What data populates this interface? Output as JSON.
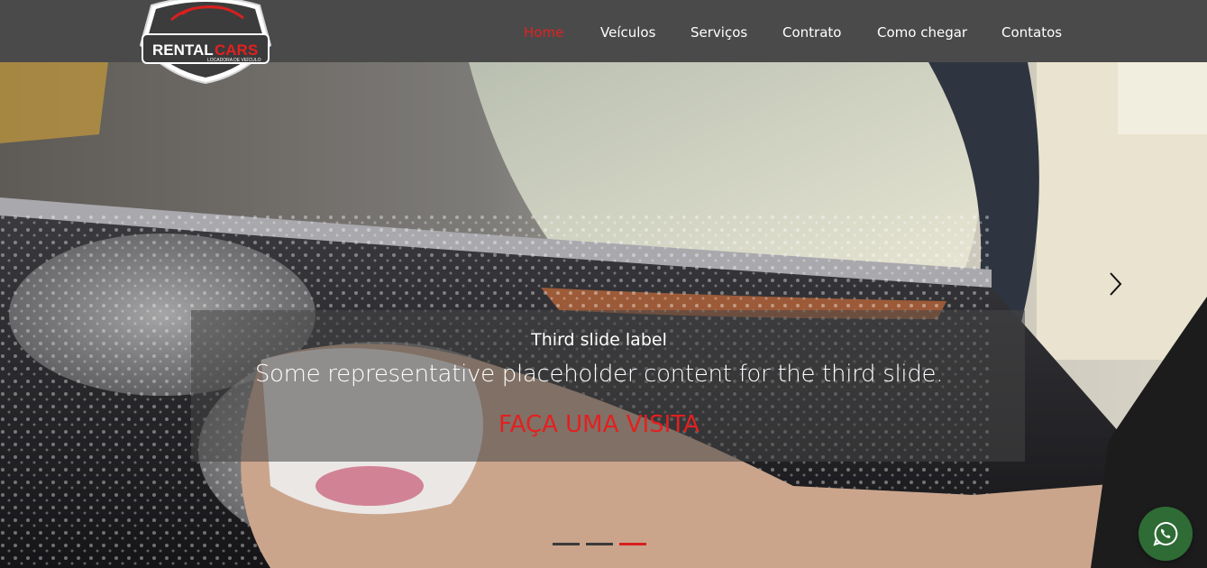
{
  "logo": {
    "brand_line1": "RENTAL",
    "brand_line2": "CARS",
    "tagline": "LOCADORA DE VEÍCULO"
  },
  "nav": {
    "items": [
      {
        "label": "Home",
        "active": true
      },
      {
        "label": "Veículos",
        "active": false
      },
      {
        "label": "Serviços",
        "active": false
      },
      {
        "label": "Contrato",
        "active": false
      },
      {
        "label": "Como chegar",
        "active": false
      },
      {
        "label": "Contatos",
        "active": false
      }
    ]
  },
  "carousel": {
    "slide_label": "Third slide label",
    "slide_text": "Some representative placeholder content for the third slide.",
    "cta": "FAÇA UMA VISITA",
    "active_index": 3,
    "slide_count": 3,
    "next_icon": "chevron-right-icon"
  },
  "floating": {
    "whatsapp_icon": "whatsapp-icon"
  },
  "colors": {
    "navbar": "#4a4a4a",
    "accent": "#e32020",
    "whatsapp": "#2e6b35"
  }
}
